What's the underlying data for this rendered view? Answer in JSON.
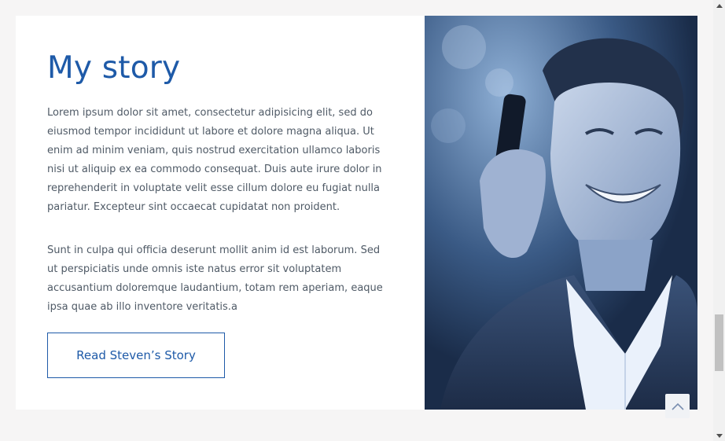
{
  "section": {
    "title": "My story",
    "paragraphs": [
      "Lorem ipsum dolor sit amet, consectetur adipisicing elit, sed do eiusmod tempor incididunt ut labore et dolore magna aliqua. Ut enim ad minim veniam, quis nostrud exercitation ullamco laboris nisi ut aliquip ex ea commodo consequat. Duis aute irure dolor in reprehenderit in voluptate velit esse cillum dolore eu fugiat nulla pariatur. Excepteur sint occaecat cupidatat non proident.",
      "Sunt in culpa qui officia deserunt mollit anim id est laborum. Sed ut perspiciatis unde omnis iste natus error sit voluptatem accusantium doloremque laudantium, totam rem aperiam, eaque ipsa quae ab illo inventore veritatis.a"
    ],
    "cta_label": "Read Steven’s Story",
    "photo_icon": "portrait-photo"
  },
  "scroll_to_top_icon": "chevron-up-icon",
  "colors": {
    "accent": "#1e5aa8",
    "body_text": "#4f5a66",
    "page_bg": "#f6f5f5",
    "card_bg": "#ffffff"
  }
}
